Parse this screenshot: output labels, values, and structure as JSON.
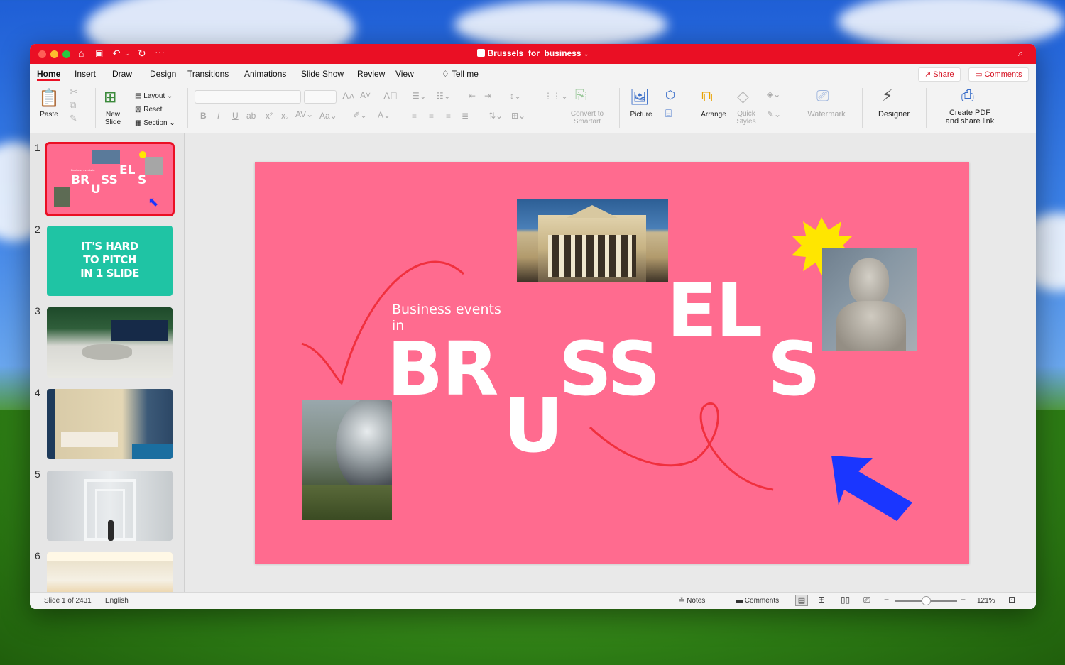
{
  "window": {
    "doc_title": "Brussels_for_business",
    "accent": "#ea0f24"
  },
  "menu": {
    "items": [
      "Home",
      "Insert",
      "Draw",
      "Design",
      "Transitions",
      "Animations",
      "Slide Show",
      "Review",
      "View"
    ],
    "tell_me": "Tell me",
    "share": "Share",
    "comments": "Comments"
  },
  "ribbon": {
    "paste": "Paste",
    "new_slide_1": "New",
    "new_slide_2": "Slide",
    "layout": "Layout",
    "reset": "Reset",
    "section": "Section",
    "convert_1": "Convert to",
    "convert_2": "Smartart",
    "picture": "Picture",
    "arrange": "Arrange",
    "quick_1": "Quick",
    "quick_2": "Styles",
    "watermark": "Watermark",
    "designer": "Designer",
    "pdf_1": "Create PDF",
    "pdf_2": "and share link"
  },
  "thumbnails": {
    "numbers": [
      "1",
      "2",
      "3",
      "4",
      "5",
      "6"
    ],
    "slide2_line1": "IT'S HARD",
    "slide2_line2": "TO PITCH",
    "slide2_line3": "IN 1 SLIDE",
    "slide1_small": "Business events in"
  },
  "slide": {
    "subtitle_line1": "Business events",
    "subtitle_line2": "in",
    "letters_br": "BR",
    "letters_u": "U",
    "letters_ss": "SS",
    "letters_el": "EL",
    "letters_s": "S",
    "bg_color": "#ff6b8f"
  },
  "status": {
    "slide_of": "Slide 1 of 2431",
    "language": "English",
    "notes": "Notes",
    "comments": "Comments",
    "zoom": "121%"
  }
}
